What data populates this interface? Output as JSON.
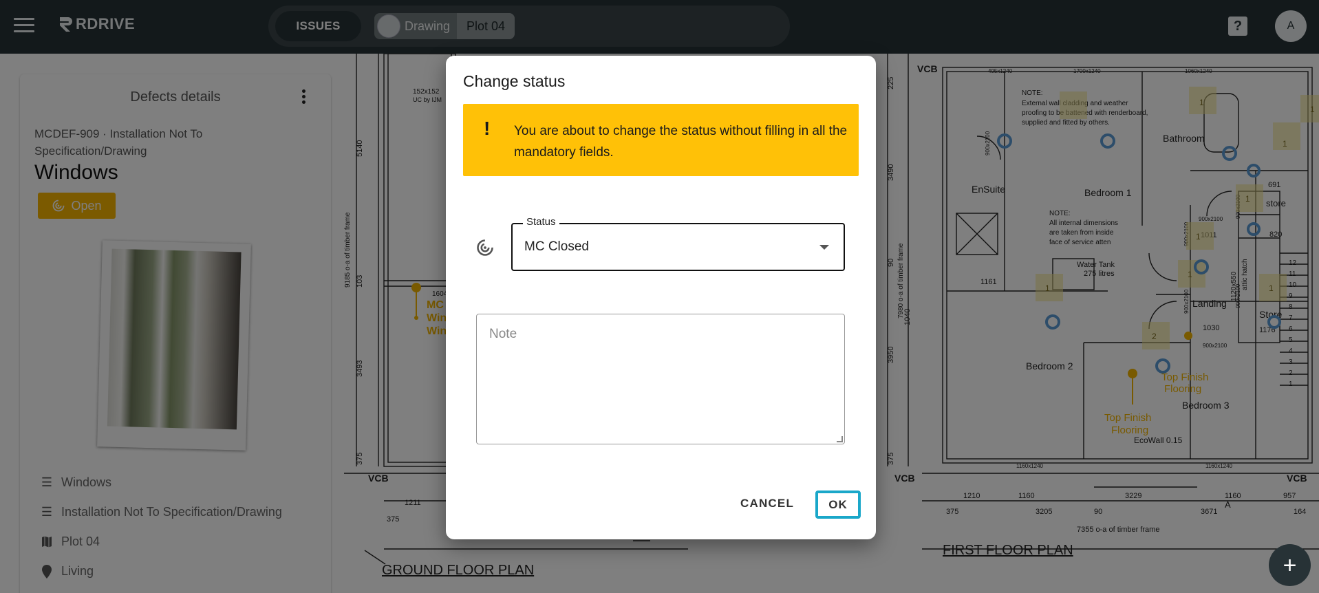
{
  "topbar": {
    "logo_text": "RDRIVE",
    "issues_label": "ISSUES",
    "breadcrumb": {
      "section": "Drawing",
      "plot": "Plot 04"
    },
    "help_label": "?",
    "avatar_initial": "A"
  },
  "defect_panel": {
    "header": "Defects details",
    "subtitle": "MCDEF-909 · Installation Not To Specification/Drawing",
    "title": "Windows",
    "status_badge": "Open",
    "details": [
      {
        "icon": "list-icon",
        "label": "Windows"
      },
      {
        "icon": "list-icon",
        "label": "Installation Not To Specification/Drawing"
      },
      {
        "icon": "map-icon",
        "label": "Plot 04"
      },
      {
        "icon": "location-pin-icon",
        "label": "Living"
      }
    ]
  },
  "drawing": {
    "labels": {
      "ground_floor": "GROUND FLOOR PLAN",
      "first_floor": "FIRST FLOOR PLAN",
      "vcb": "VCB",
      "bathroom": "Bathroom",
      "ensuite": "EnSuite",
      "bedroom1": "Bedroom 1",
      "bedroom2": "Bedroom 2",
      "bedroom3": "Bedroom 3",
      "landing": "Landing",
      "store": "Store",
      "store_small": "store",
      "water_tank": "Water Tank",
      "water_tank_volume": "275 litres",
      "ecowall": "EcoWall 0.15",
      "note1_title": "NOTE:",
      "note1_line1": "External wall cladding and weather",
      "note1_line2": "proofing to be battened with renderboard,",
      "note1_line3": "supplied and fitted by others.",
      "note2_title": "NOTE:",
      "note2_line1": "All internal dimensions",
      "note2_line2": "are taken from inside",
      "note2_line3": "face of service  atten",
      "uc": "152x152",
      "uc2": "UC by IJM",
      "attic_hatch": "attic hatch",
      "timber_left": "9185  o-a of timber frame",
      "timber_right": "7980  o-a of timber frame",
      "timber_bottom": "7355  o-a of timber frame",
      "top_finish_1": "Top Finish",
      "top_finish_1b": "Flooring",
      "top_finish_2": "Top Finish",
      "top_finish_2b": "Flooring",
      "pin_text_1": "MC",
      "pin_text_2": "Win",
      "pin_text_3": "Win"
    },
    "dims": {
      "d5140": "5140",
      "d103": "103",
      "d3493": "3493",
      "d375a": "375",
      "d1211": "1211",
      "d375b": "375",
      "d1604": "1604",
      "d225": "225",
      "d3490": "3490",
      "d90a": "90",
      "d1040": "1040",
      "d3950": "3950",
      "d375c": "375",
      "b1210": "1210",
      "b1160a": "1160",
      "b3229": "3229",
      "b1160b": "1160",
      "b957": "957",
      "b375": "375",
      "b3205": "3205",
      "b90": "90",
      "b3671": "3671",
      "b164": "164",
      "r691": "691",
      "r820": "820",
      "r1011": "1011",
      "r1030": "1030",
      "r1176": "1176",
      "r1161": "1161",
      "r1120": "1120x550",
      "rA": "A",
      "s12": "12",
      "s11": "11",
      "s10": "10",
      "s9": "9",
      "s8": "8",
      "s7": "7",
      "s6": "6",
      "s5": "5",
      "s4": "4",
      "s3": "3",
      "s2": "2",
      "s1": "1",
      "w1": "495x1240",
      "w2": "1700x1240",
      "w3": "1060x1240",
      "w4": "1160x1240",
      "w5": "1160x1240",
      "dr1": "900x2100",
      "dr2": "900x2100",
      "dr3": "900x2100",
      "dr4": "900x2100",
      "dr5": "900x2100",
      "dr6": "900x2100",
      "dr7": "900x2100",
      "m1": "1",
      "m2": "1",
      "m3": "1",
      "m4": "1",
      "m5": "2",
      "m6": "1",
      "m7": "1",
      "m8": "1",
      "m9": "1"
    }
  },
  "dialog": {
    "title": "Change status",
    "warning": "You are about to change the status without filling in all the mandatory fields.",
    "warning_icon": "!",
    "status_label": "Status",
    "status_value": "MC Closed",
    "note_placeholder": "Note",
    "cancel_label": "CANCEL",
    "ok_label": "OK"
  },
  "fab_label": "+",
  "colors": {
    "topbar": "#273236",
    "accent_yellow": "#ffc107",
    "open_badge": "#f6b400",
    "focus_ring": "#1aa7c9",
    "pin_blue": "#5b9bd5"
  }
}
